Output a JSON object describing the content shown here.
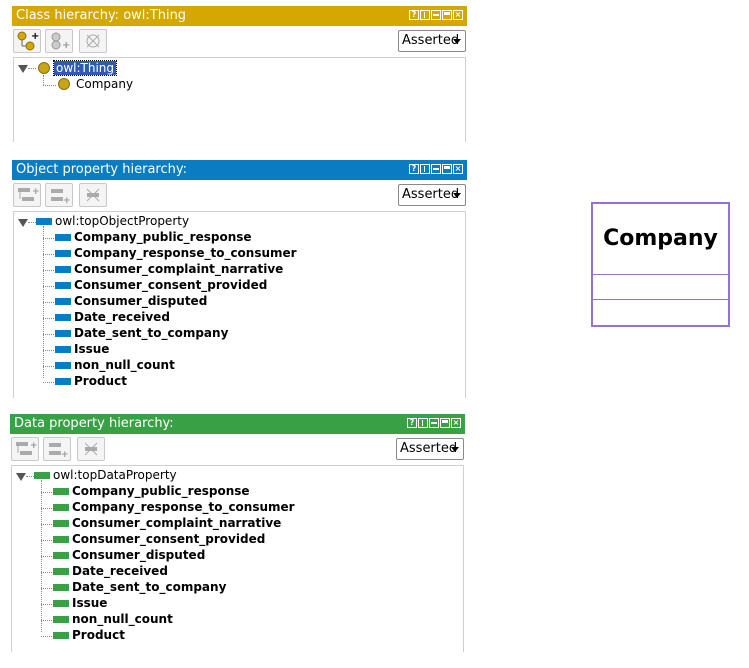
{
  "colors": {
    "class_accent": "#d4a800",
    "object_accent": "#0a7cc1",
    "data_accent": "#3aa045",
    "uml_border": "#9370db",
    "selection": "#2f5bb4"
  },
  "class_panel": {
    "title": "Class hierarchy: owl:Thing",
    "window_buttons": [
      "?",
      "restore",
      "minimize",
      "maximize",
      "close"
    ],
    "toolbar": [
      "add-subclass-icon",
      "add-sibling-class-icon",
      "delete-class-icon"
    ],
    "view_mode": "Asserted",
    "root": "owl:Thing",
    "children": [
      "Company"
    ]
  },
  "object_panel": {
    "title": "Object property hierarchy:",
    "view_mode": "Asserted",
    "root": "owl:topObjectProperty",
    "children": [
      "Company_public_response",
      "Company_response_to_consumer",
      "Consumer_complaint_narrative",
      "Consumer_consent_provided",
      "Consumer_disputed",
      "Date_received",
      "Date_sent_to_company",
      "Issue",
      "non_null_count",
      "Product"
    ]
  },
  "data_panel": {
    "title": "Data property hierarchy:",
    "view_mode": "Asserted",
    "root": "owl:topDataProperty",
    "children": [
      "Company_public_response",
      "Company_response_to_consumer",
      "Consumer_complaint_narrative",
      "Consumer_consent_provided",
      "Consumer_disputed",
      "Date_received",
      "Date_sent_to_company",
      "Issue",
      "non_null_count",
      "Product"
    ]
  },
  "uml": {
    "class_name": "Company"
  }
}
